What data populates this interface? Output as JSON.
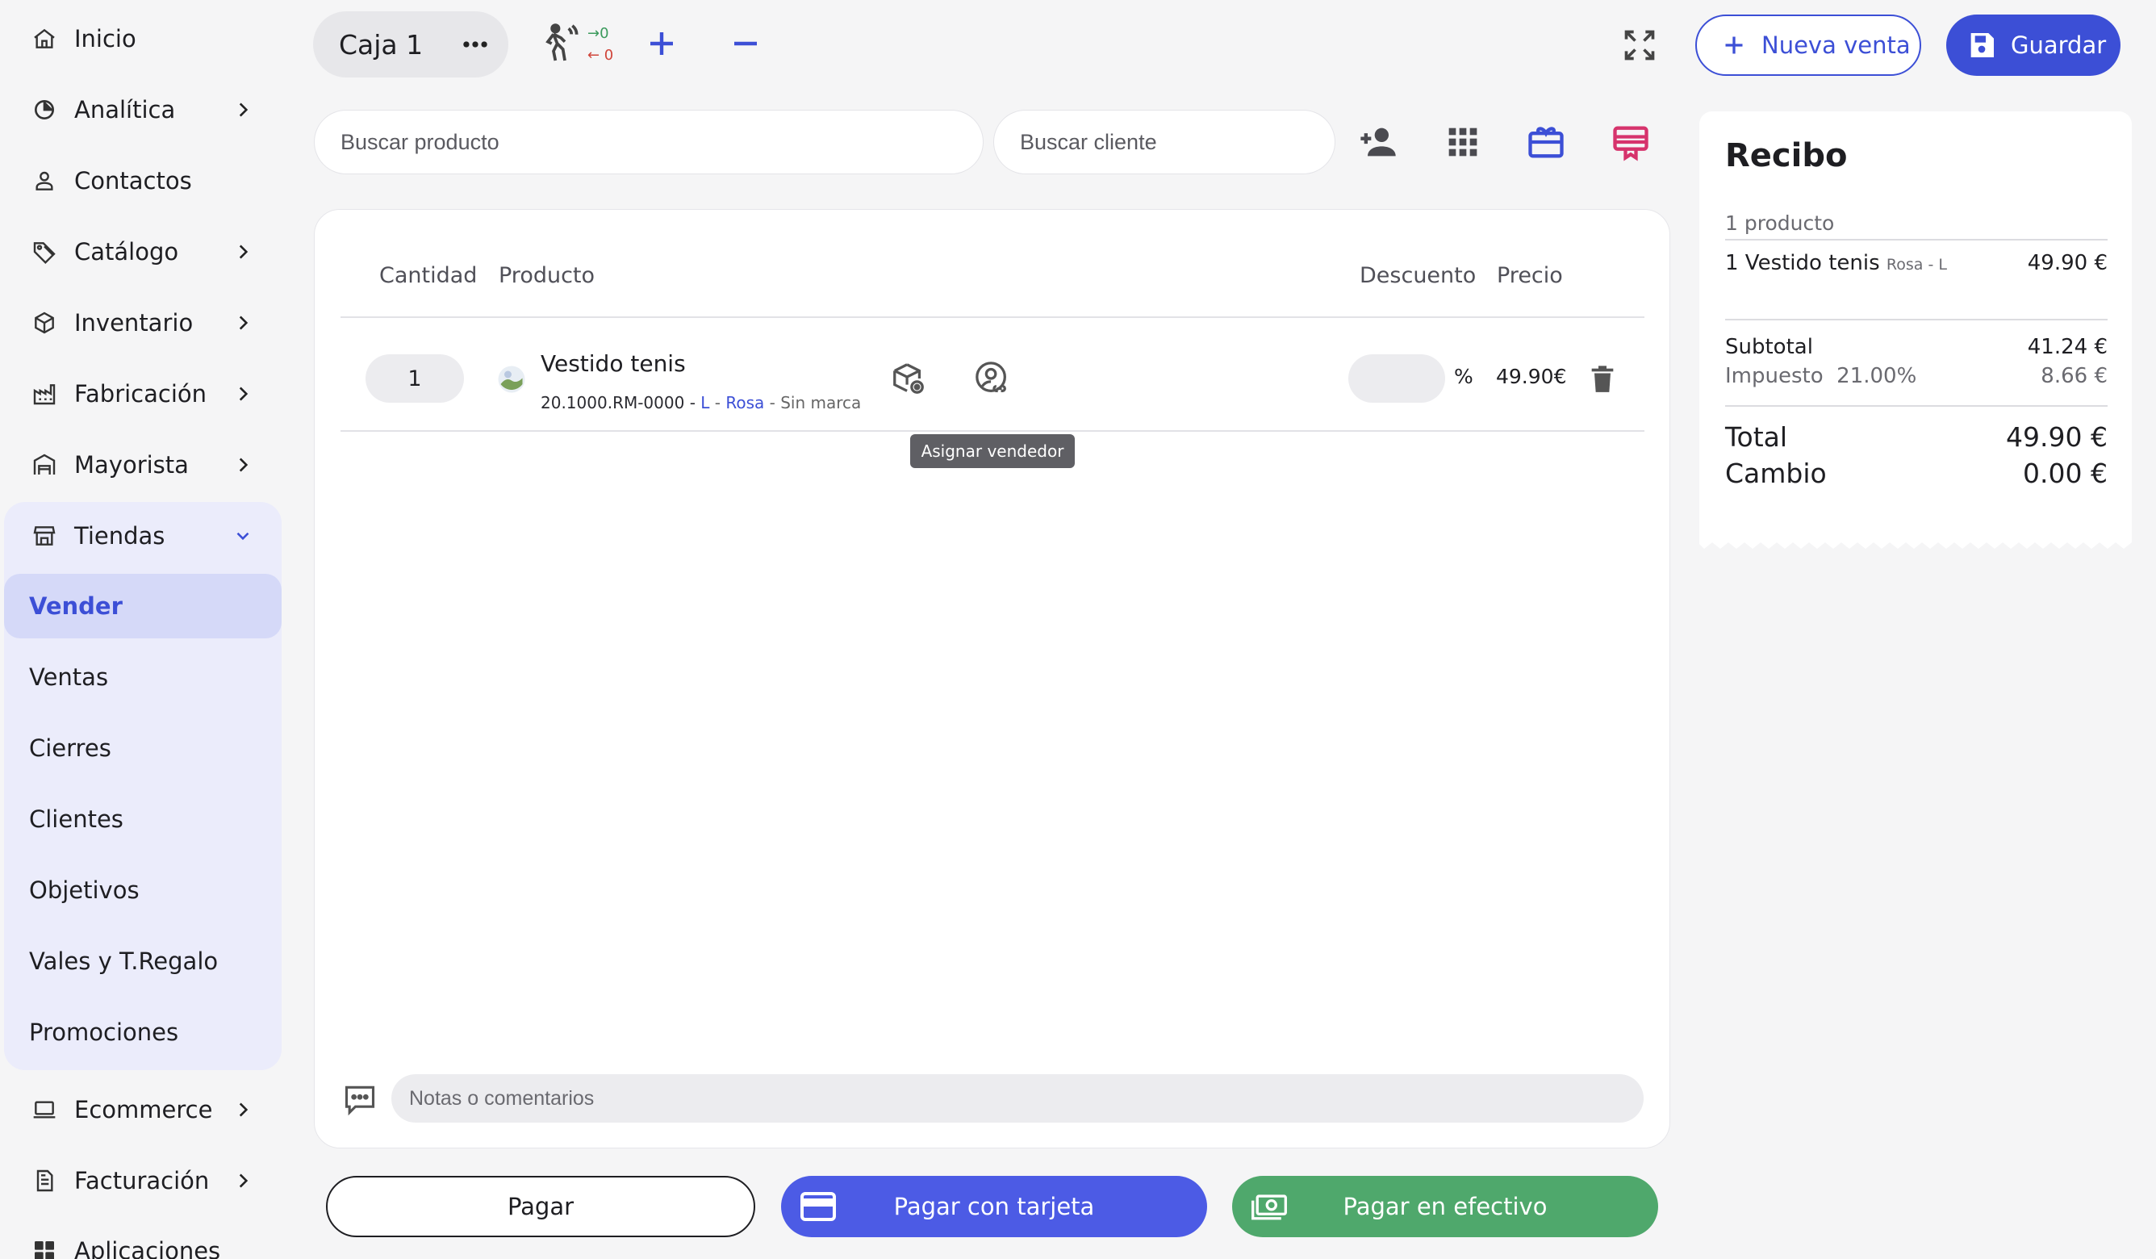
{
  "sidebar": {
    "items": [
      {
        "label": "Inicio"
      },
      {
        "label": "Analítica"
      },
      {
        "label": "Contactos"
      },
      {
        "label": "Catálogo"
      },
      {
        "label": "Inventario"
      },
      {
        "label": "Fabricación"
      },
      {
        "label": "Mayorista"
      },
      {
        "label": "Tiendas"
      },
      {
        "label": "Ecommerce"
      },
      {
        "label": "Facturación"
      },
      {
        "label": "Aplicaciones"
      }
    ],
    "tiendas_sub": [
      {
        "label": "Vender"
      },
      {
        "label": "Ventas"
      },
      {
        "label": "Cierres"
      },
      {
        "label": "Clientes"
      },
      {
        "label": "Objetivos"
      },
      {
        "label": "Vales y T.Regalo"
      },
      {
        "label": "Promociones"
      }
    ]
  },
  "topbar": {
    "caja": "Caja 1",
    "in_count": "→0",
    "out_count": "← 0",
    "new_sale": "Nueva venta",
    "save": "Guardar"
  },
  "search": {
    "product_placeholder": "Buscar producto",
    "client_placeholder": "Buscar cliente"
  },
  "table": {
    "headers": {
      "quantity": "Cantidad",
      "product": "Producto",
      "discount": "Descuento",
      "price": "Precio"
    },
    "rows": [
      {
        "qty": "1",
        "name": "Vestido tenis",
        "sku": "20.1000.RM-0000",
        "sep1": " - ",
        "size": "L",
        "sep2": " - ",
        "color": "Rosa",
        "sep3": " - ",
        "brand": "Sin marca",
        "pct": "%",
        "price": "49.90€"
      }
    ]
  },
  "tooltip": "Asignar vendedor",
  "notes_placeholder": "Notas o comentarios",
  "pay": {
    "plain": "Pagar",
    "card": "Pagar con tarjeta",
    "cash": "Pagar en efectivo"
  },
  "receipt": {
    "title": "Recibo",
    "count": "1 producto",
    "item_name": "1 Vestido tenis",
    "item_variant": "Rosa - L",
    "item_price": "49.90 €",
    "subtotal_label": "Subtotal",
    "subtotal": "41.24 €",
    "tax_label": "Impuesto  21.00%",
    "tax": "8.66 €",
    "total_label": "Total",
    "total": "49.90 €",
    "change_label": "Cambio",
    "change": "0.00 €"
  },
  "colors": {
    "accent": "#3c4fd6",
    "card_button": "#4c5be5",
    "cash_button": "#4fa86c",
    "subnav_bg": "#ebecfb",
    "active_bg": "#d5d9f8",
    "gift_icon": "#d6336c"
  }
}
